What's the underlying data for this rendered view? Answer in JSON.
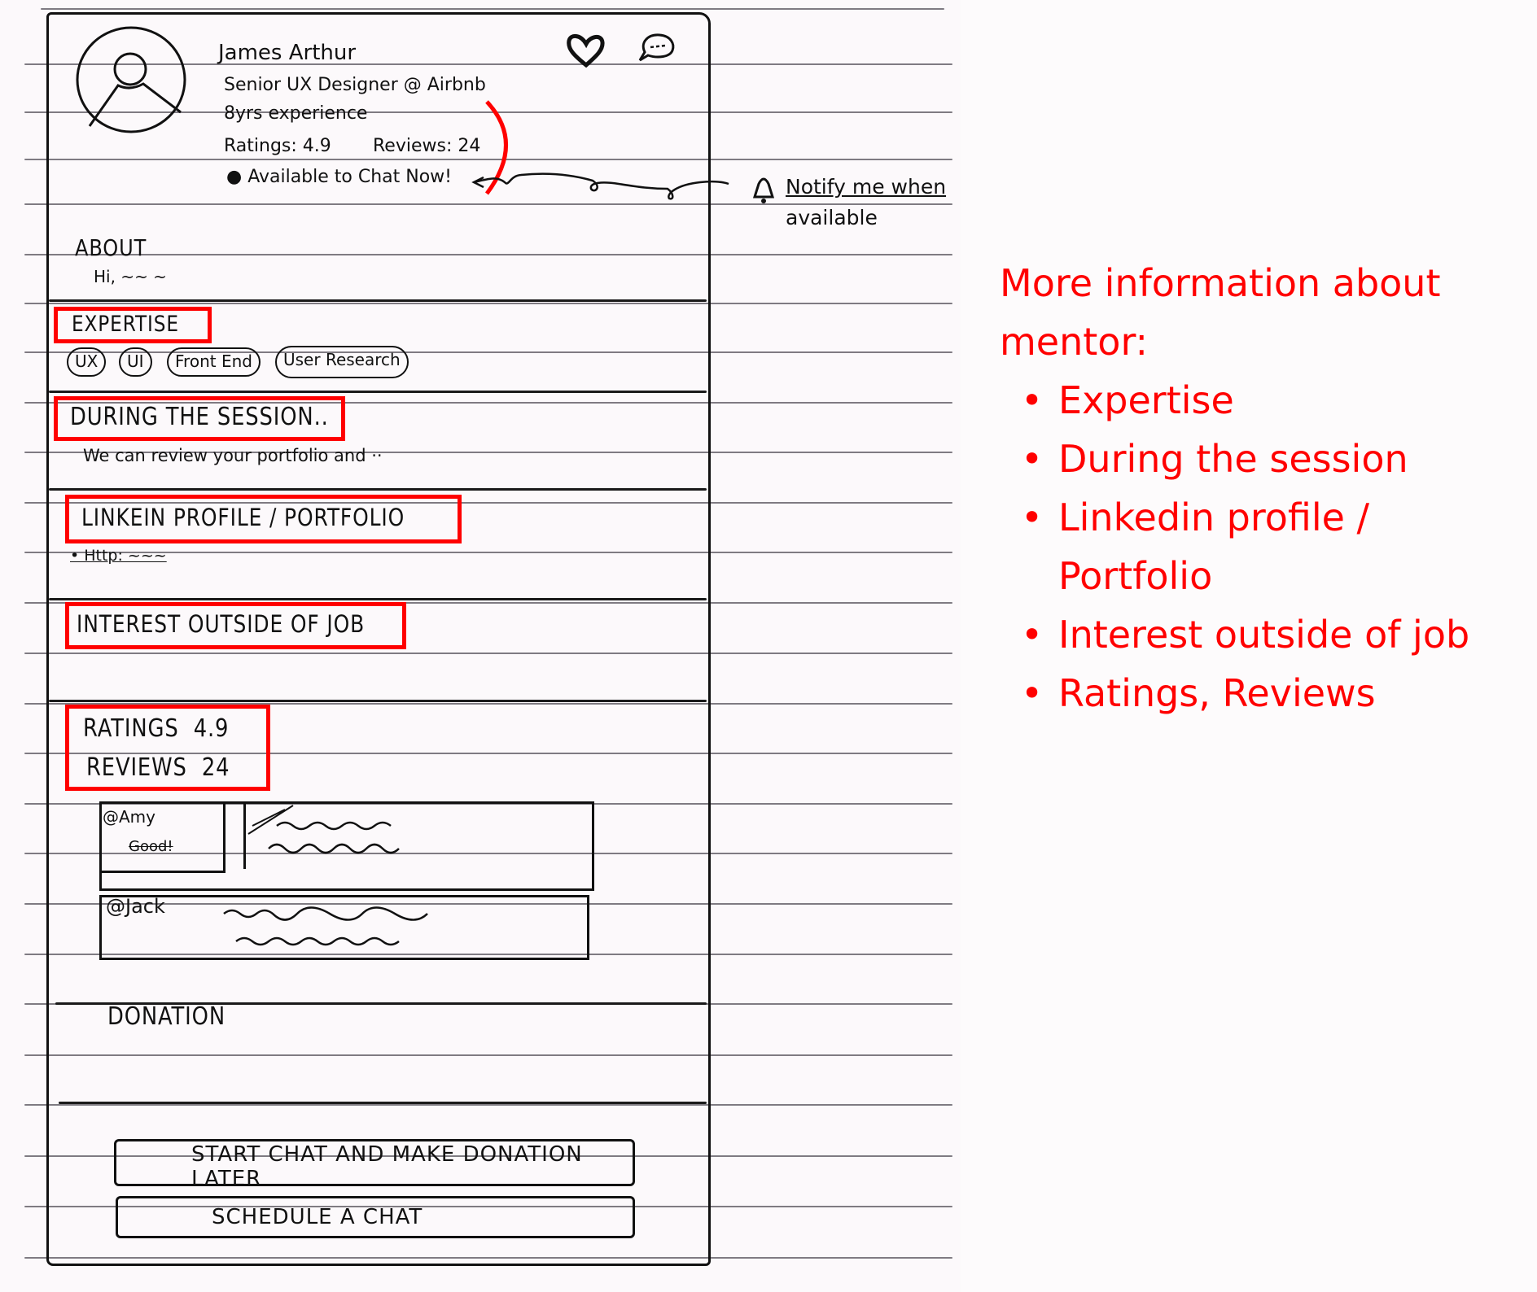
{
  "profile": {
    "name": "James Arthur",
    "title": "Senior UX Designer @ Airbnb",
    "experience": "8yrs experience",
    "ratings_label": "Ratings: 4.9",
    "reviews_label": "Reviews: 24",
    "availability": "Available to Chat Now!",
    "icons": {
      "favorite": "heart-icon",
      "message": "chat-bubble-icon",
      "avatar": "user-avatar-icon"
    }
  },
  "notify": {
    "label_line1": "Notify me when",
    "label_line2": "available",
    "icon": "bell-icon"
  },
  "sections": {
    "about": {
      "heading": "About",
      "text": "Hi, ~~ ~"
    },
    "expertise": {
      "heading": "Expertise",
      "chips": [
        "UX",
        "UI",
        "Front End",
        "User Research"
      ]
    },
    "session": {
      "heading": "During the session..",
      "text": "We can review your portfolio and ··"
    },
    "linkedin": {
      "heading": "Linkein Profile / Portfolio",
      "text": "• Http: ~~~"
    },
    "interest": {
      "heading": "Interest outside of job"
    },
    "ratings": {
      "ratings_label": "Ratings",
      "ratings_value": "4.9",
      "reviews_label": "Reviews",
      "reviews_value": "24"
    },
    "reviews": [
      {
        "author": "@Amy",
        "text": "Good!"
      },
      {
        "author": "@Jack",
        "text": ""
      }
    ],
    "donation": {
      "heading": "Donation"
    }
  },
  "actions": {
    "start_chat": "Start chat  and make donation later",
    "schedule": "Schedule  a chat"
  },
  "annotation": {
    "title": "More information about mentor:",
    "items": [
      "Expertise",
      "During the session",
      "Linkedin profile / Portfolio",
      "Interest outside of job",
      "Ratings, Reviews"
    ],
    "color": "#ff0000"
  }
}
